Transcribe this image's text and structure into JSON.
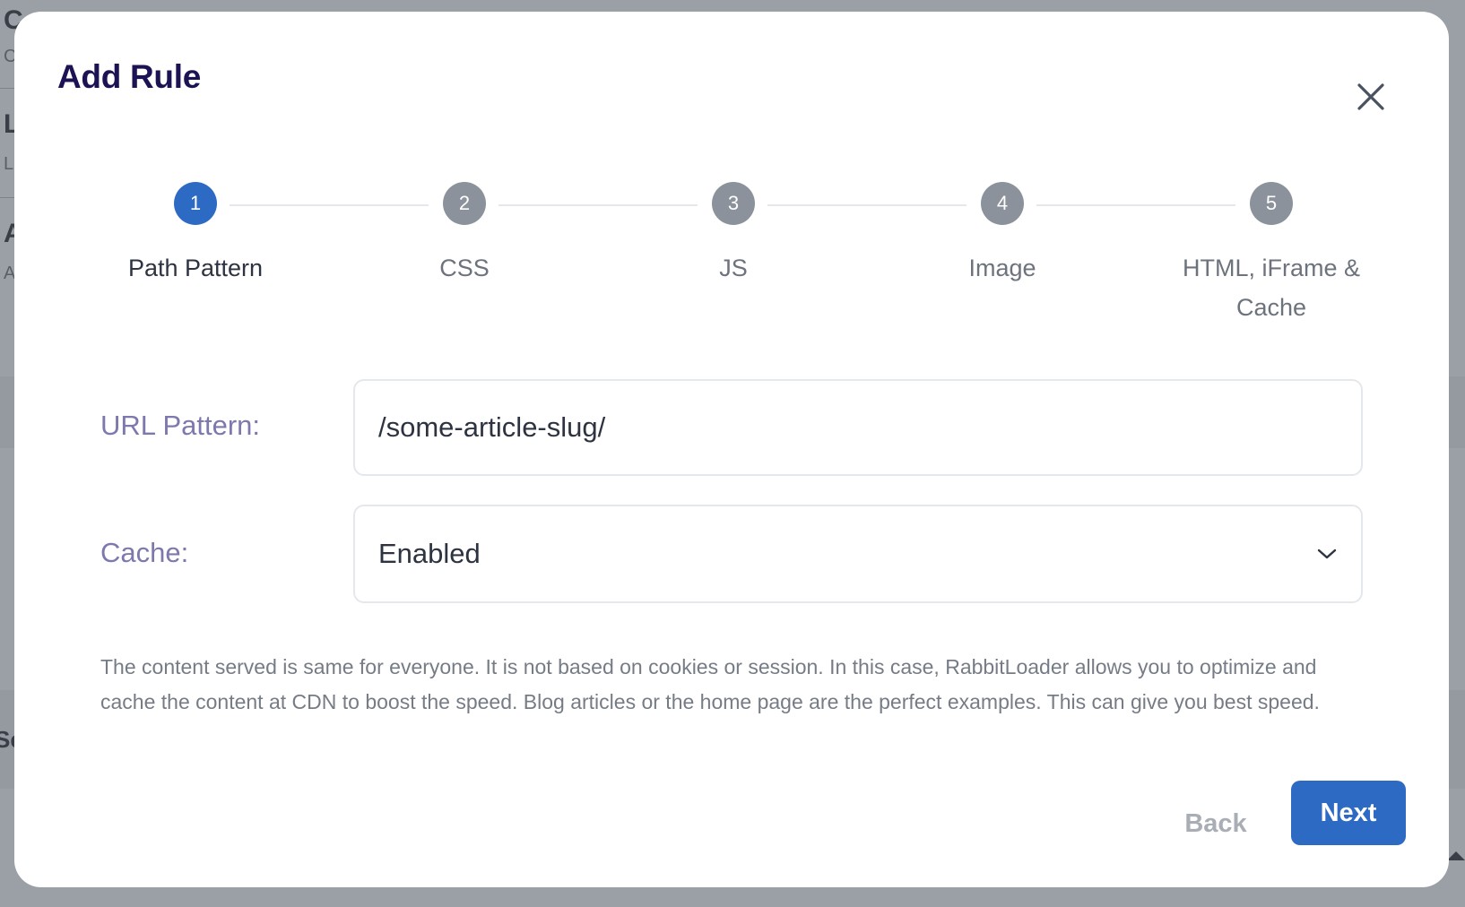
{
  "background": {
    "fragments": [
      "C",
      "C",
      "L",
      "L",
      "A",
      "A",
      "Se"
    ]
  },
  "modal": {
    "title": "Add Rule",
    "close_icon": "close-icon"
  },
  "stepper": {
    "steps": [
      {
        "number": "1",
        "label": "Path Pattern",
        "state": "active"
      },
      {
        "number": "2",
        "label": "CSS",
        "state": "pending"
      },
      {
        "number": "3",
        "label": "JS",
        "state": "pending"
      },
      {
        "number": "4",
        "label": "Image",
        "state": "pending"
      },
      {
        "number": "5",
        "label": "HTML, iFrame & Cache",
        "state": "pending"
      }
    ]
  },
  "form": {
    "url_pattern": {
      "label": "URL Pattern:",
      "value": "/some-article-slug/"
    },
    "cache": {
      "label": "Cache:",
      "value": "Enabled",
      "icon": "chevron-down-icon"
    },
    "help_text": "The content served is same for everyone. It is not based on cookies or session. In this case, RabbitLoader allows you to optimize and cache the content at CDN to boost the speed. Blog articles or the home page are the perfect examples. This can give you best speed."
  },
  "footer": {
    "back_label": "Back",
    "next_label": "Next"
  },
  "colors": {
    "accent": "#2d6ac4",
    "title": "#1b1353",
    "label": "#7d78ae",
    "step_pending": "#8b929b",
    "overlay": "#9ba0a7"
  }
}
